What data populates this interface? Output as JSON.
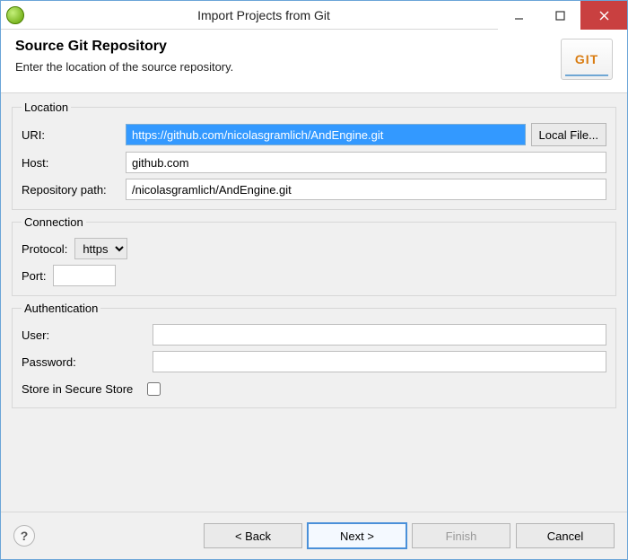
{
  "window": {
    "title": "Import Projects from Git"
  },
  "header": {
    "heading": "Source Git Repository",
    "subtext": "Enter the location of the source repository.",
    "badge": "GIT"
  },
  "location": {
    "legend": "Location",
    "uri_label": "URI:",
    "uri_value": "https://github.com/nicolasgramlich/AndEngine.git",
    "local_file_label": "Local File...",
    "host_label": "Host:",
    "host_value": "github.com",
    "repo_path_label": "Repository path:",
    "repo_path_value": "/nicolasgramlich/AndEngine.git"
  },
  "connection": {
    "legend": "Connection",
    "protocol_label": "Protocol:",
    "protocol_value": "https",
    "port_label": "Port:",
    "port_value": ""
  },
  "auth": {
    "legend": "Authentication",
    "user_label": "User:",
    "user_value": "",
    "password_label": "Password:",
    "password_value": "",
    "store_label": "Store in Secure Store"
  },
  "footer": {
    "back": "< Back",
    "next": "Next >",
    "finish": "Finish",
    "cancel": "Cancel"
  }
}
